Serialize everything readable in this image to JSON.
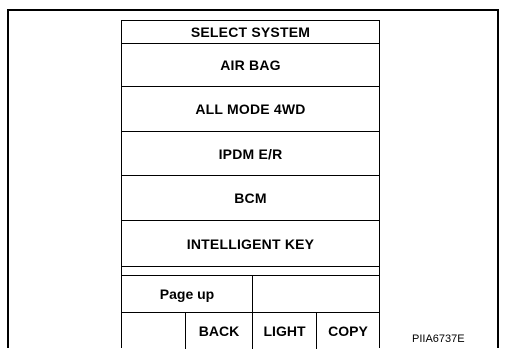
{
  "screen": {
    "title": "SELECT SYSTEM",
    "systems": [
      "AIR BAG",
      "ALL MODE 4WD",
      "IPDM E/R",
      "BCM",
      "INTELLIGENT KEY"
    ],
    "nav": {
      "page_up": "Page up"
    },
    "buttons": {
      "back": "BACK",
      "light": "LIGHT",
      "copy": "COPY"
    }
  },
  "figure_code": "PIIA6737E"
}
